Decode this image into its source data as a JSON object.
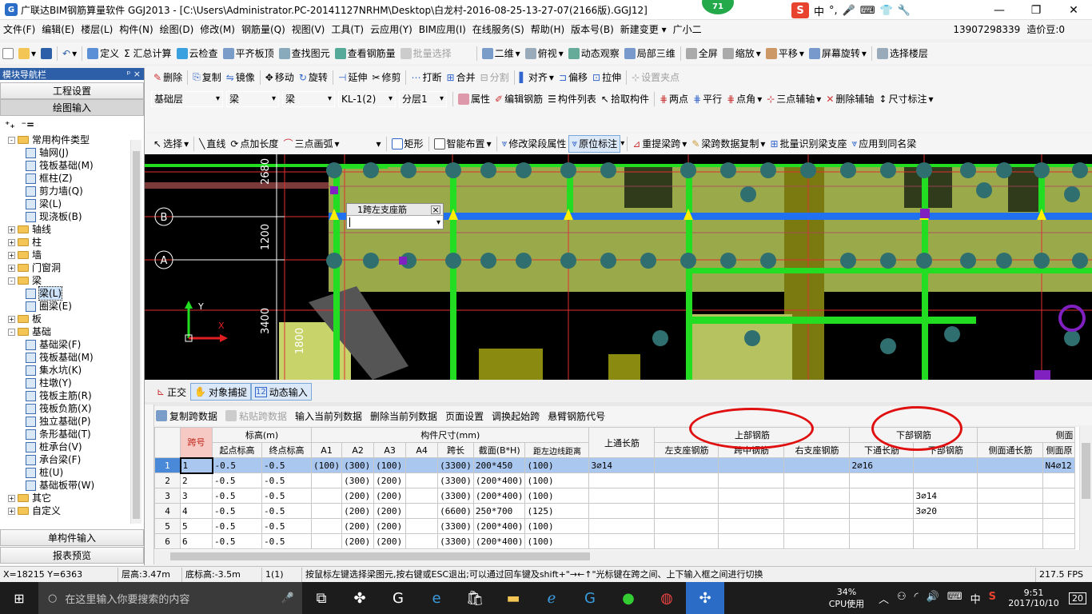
{
  "window": {
    "title": "广联达BIM钢筋算量软件 GGJ2013 - [C:\\Users\\Administrator.PC-20141127NRHM\\Desktop\\白龙村-2016-08-25-13-27-07(2166版).GGJ12]",
    "badge": "71",
    "minimize": "—",
    "restore": "❐",
    "close": "✕"
  },
  "ime": {
    "brand": "S",
    "mode": "中"
  },
  "menu": [
    "文件(F)",
    "编辑(E)",
    "楼层(L)",
    "构件(N)",
    "绘图(D)",
    "修改(M)",
    "钢筋量(Q)",
    "视图(V)",
    "工具(T)",
    "云应用(Y)",
    "BIM应用(I)",
    "在线服务(S)",
    "帮助(H)",
    "版本号(B)",
    "新建变更 ▾",
    "广小二"
  ],
  "account": {
    "phone": "13907298339",
    "price": "造价豆:0"
  },
  "toolbar1": [
    "定义",
    "Σ 汇总计算",
    "云检查",
    "平齐板顶",
    "查找图元",
    "查看钢筋量",
    "批量选择",
    "二维",
    "俯视",
    "动态观察",
    "局部三维",
    "全屏",
    "缩放",
    "平移",
    "屏幕旋转",
    "选择楼层"
  ],
  "toolbar2": [
    "删除",
    "复制",
    "镜像",
    "移动",
    "旋转",
    "延伸",
    "修剪",
    "打断",
    "合并",
    "分割",
    "对齐",
    "偏移",
    "拉伸",
    "设置夹点"
  ],
  "toolbar3": {
    "floor": "基础层",
    "type1": "梁",
    "type2": "梁",
    "member": "KL-1(2)",
    "layer": "分层1",
    "items": [
      "属性",
      "编辑钢筋",
      "构件列表",
      "拾取构件",
      "两点",
      "平行",
      "点角",
      "三点辅轴",
      "删除辅轴",
      "尺寸标注"
    ]
  },
  "toolbar4": [
    "选择",
    "直线",
    "点加长度",
    "三点画弧",
    "矩形",
    "智能布置",
    "修改梁段属性",
    "原位标注",
    "重提梁跨",
    "梁跨数据复制",
    "批量识别梁支座",
    "应用到同名梁"
  ],
  "nav": {
    "title": "模块导航栏",
    "pin": "ᵖ ×",
    "btn1": "工程设置",
    "btn2": "绘图输入",
    "btn3": "单构件输入",
    "btn4": "报表预览",
    "tree": [
      {
        "d": 0,
        "e": "-",
        "f": true,
        "t": "常用构件类型"
      },
      {
        "d": 1,
        "t": "轴网(J)"
      },
      {
        "d": 1,
        "t": "筏板基础(M)"
      },
      {
        "d": 1,
        "t": "框柱(Z)"
      },
      {
        "d": 1,
        "t": "剪力墙(Q)"
      },
      {
        "d": 1,
        "t": "梁(L)"
      },
      {
        "d": 1,
        "t": "现浇板(B)"
      },
      {
        "d": 0,
        "e": "+",
        "f": true,
        "t": "轴线"
      },
      {
        "d": 0,
        "e": "+",
        "f": true,
        "t": "柱"
      },
      {
        "d": 0,
        "e": "+",
        "f": true,
        "t": "墙"
      },
      {
        "d": 0,
        "e": "+",
        "f": true,
        "t": "门窗洞"
      },
      {
        "d": 0,
        "e": "-",
        "f": true,
        "t": "梁"
      },
      {
        "d": 1,
        "t": "梁(L)",
        "sel": true
      },
      {
        "d": 1,
        "t": "圈梁(E)"
      },
      {
        "d": 0,
        "e": "+",
        "f": true,
        "t": "板"
      },
      {
        "d": 0,
        "e": "-",
        "f": true,
        "t": "基础"
      },
      {
        "d": 1,
        "t": "基础梁(F)"
      },
      {
        "d": 1,
        "t": "筏板基础(M)"
      },
      {
        "d": 1,
        "t": "集水坑(K)"
      },
      {
        "d": 1,
        "t": "柱墩(Y)"
      },
      {
        "d": 1,
        "t": "筏板主筋(R)"
      },
      {
        "d": 1,
        "t": "筏板负筋(X)"
      },
      {
        "d": 1,
        "t": "独立基础(P)"
      },
      {
        "d": 1,
        "t": "条形基础(T)"
      },
      {
        "d": 1,
        "t": "桩承台(V)"
      },
      {
        "d": 1,
        "t": "承台梁(F)"
      },
      {
        "d": 1,
        "t": "桩(U)"
      },
      {
        "d": 1,
        "t": "基础板带(W)"
      },
      {
        "d": 0,
        "e": "+",
        "f": true,
        "t": "其它"
      },
      {
        "d": 0,
        "e": "+",
        "f": true,
        "t": "自定义"
      }
    ]
  },
  "canvas": {
    "axis_b": "B",
    "axis_a": "A",
    "dims": [
      "2680",
      "1200",
      "3400",
      "1800"
    ],
    "popup_title": "1跨左支座筋",
    "popup_close": "×",
    "axis_y": "Y",
    "axis_x": "X"
  },
  "snapbar": [
    "正交",
    "对象捕捉",
    "动态输入"
  ],
  "tblbar": [
    "复制跨数据",
    "粘贴跨数据",
    "输入当前列数据",
    "删除当前列数据",
    "页面设置",
    "调换起始跨",
    "悬臂钢筋代号"
  ],
  "table": {
    "h_span": "跨号",
    "h_elev": "标高(m)",
    "h_size": "构件尺寸(mm)",
    "h_top": "上通长筋",
    "h_upper": "上部钢筋",
    "h_lower": "下部钢筋",
    "h_side": "侧面",
    "sub": [
      "起点标高",
      "终点标高",
      "A1",
      "A2",
      "A3",
      "A4",
      "跨长",
      "截面(B*H)",
      "距左边线距离",
      "左支座钢筋",
      "跨中钢筋",
      "右支座钢筋",
      "下通长筋",
      "下部钢筋",
      "侧面通长筋",
      "侧面原"
    ],
    "rows": [
      [
        "1",
        "1",
        "-0.5",
        "-0.5",
        "(100)",
        "(300)",
        "(100)",
        "",
        "(3300)",
        "200*450",
        "(100)",
        "3⌀14",
        "",
        "",
        "",
        "2⌀16",
        "",
        "",
        "N4⌀12"
      ],
      [
        "2",
        "2",
        "-0.5",
        "-0.5",
        "",
        "(300)",
        "(200)",
        "",
        "(3300)",
        "(200*400)",
        "(100)",
        "",
        "",
        "",
        "",
        "",
        "",
        "",
        ""
      ],
      [
        "3",
        "3",
        "-0.5",
        "-0.5",
        "",
        "(200)",
        "(200)",
        "",
        "(3300)",
        "(200*400)",
        "(100)",
        "",
        "",
        "",
        "",
        "",
        "3⌀14",
        "",
        ""
      ],
      [
        "4",
        "4",
        "-0.5",
        "-0.5",
        "",
        "(200)",
        "(200)",
        "",
        "(6600)",
        "250*700",
        "(125)",
        "",
        "",
        "",
        "",
        "",
        "3⌀20",
        "",
        ""
      ],
      [
        "5",
        "5",
        "-0.5",
        "-0.5",
        "",
        "(200)",
        "(200)",
        "",
        "(3300)",
        "(200*400)",
        "(100)",
        "",
        "",
        "",
        "",
        "",
        "",
        "",
        ""
      ],
      [
        "6",
        "6",
        "-0.5",
        "-0.5",
        "",
        "(200)",
        "(200)",
        "",
        "(3300)",
        "(200*400)",
        "(100)",
        "",
        "",
        "",
        "",
        "",
        "",
        "",
        ""
      ]
    ]
  },
  "status": {
    "coord": "X=18215 Y=6363",
    "floor_h": "层高:3.47m",
    "base_h": "底标高:-3.5m",
    "cnt": "1(1)",
    "hint": "按鼠标左键选择梁图元,按右键或ESC退出;可以通过回车键及shift+\"→←↑\"光标键在跨之间、上下输入框之间进行切换",
    "fps": "217.5 FPS"
  },
  "taskbar": {
    "search": "在这里输入你要搜索的内容",
    "cpu_pct": "34%",
    "cpu_lbl": "CPU使用",
    "lang": "中",
    "time": "9:51",
    "date": "2017/10/10",
    "notif": "20"
  }
}
